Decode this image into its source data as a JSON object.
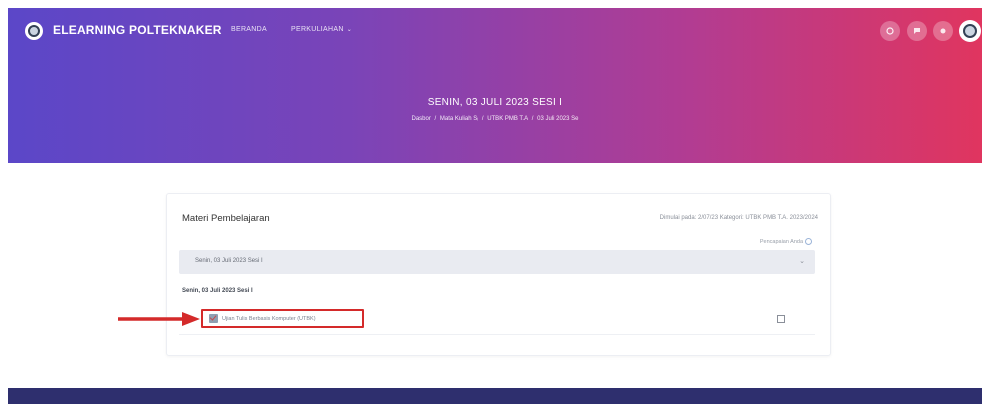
{
  "navbar": {
    "brand": "ELEARNING POLTEKNAKER",
    "links": [
      {
        "label": "BERANDA"
      },
      {
        "label": "PERKULIAHAN"
      }
    ],
    "dropdown_caret": "⌄",
    "icons": [
      "settings-icon",
      "chat-icon",
      "notification-icon",
      "user-avatar"
    ]
  },
  "header": {
    "title": "SENIN, 03 JULI 2023 SESI I",
    "breadcrumb": [
      "Dasbor",
      "Mata Kuliah Sᵢ",
      "UTBK PMB T.A",
      "03 Juli 2023 Se"
    ],
    "breadcrumb_separator": "/"
  },
  "course": {
    "title": "Materi Pembelajaran",
    "meta": "Dimulai pada: 2/07/23 Kategori: UTBK PMB T.A. 2023/2024",
    "progress_label": "Pencapaian Anda",
    "section_label": "Senin, 03 Juli 2023 Sesi I",
    "section_heading": "Senin, 03 Juli 2023 Sesi I",
    "activity_label": "Ujian Tulis Berbasis Komputer (UTBK)",
    "activity_completed": false
  },
  "colors": {
    "gradient_start": "#5b47c8",
    "gradient_end": "#e0355f",
    "highlight": "#d42a2a",
    "footer": "#2e2f6e"
  }
}
